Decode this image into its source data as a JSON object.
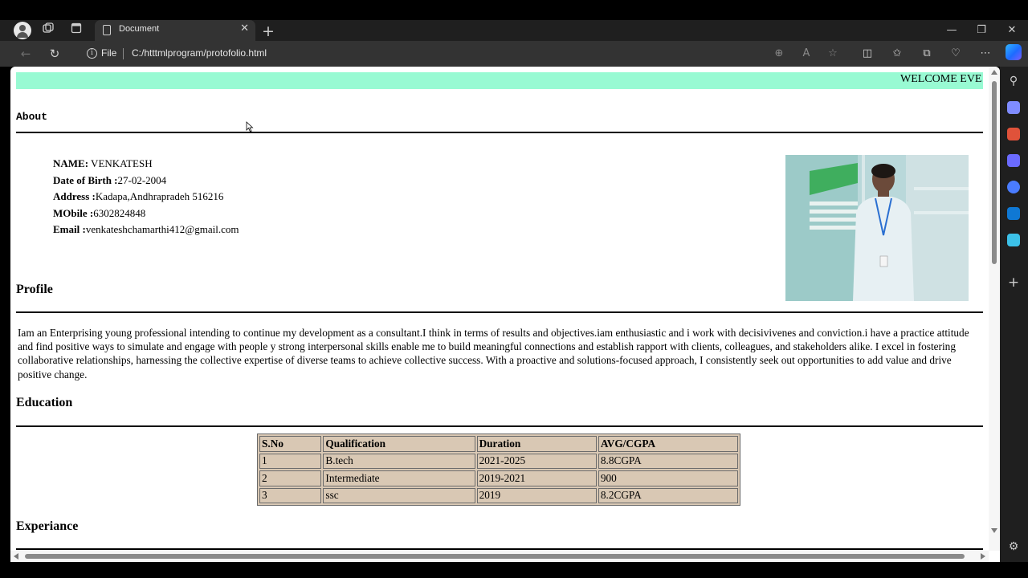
{
  "browser": {
    "tab_title": "Document",
    "tab_close": "✕",
    "new_tab": "+",
    "url_scheme": "File",
    "url": "C:/htttmlprogram/protofolio.html",
    "window_controls": {
      "minimize": "—",
      "restore": "❐",
      "close": "✕"
    }
  },
  "icons": {
    "back": "←",
    "reload": "↻",
    "zoom": "⊕",
    "read_aloud": "A",
    "favorite": "☆",
    "split": "◫",
    "favorites": "✩",
    "collections": "⧉",
    "performance": "♡",
    "more": "⋯",
    "search": "⚲",
    "add": "+",
    "settings": "⚙"
  },
  "sidebar_colors": [
    "#7f8cff",
    "#e0523a",
    "#6b6bff",
    "#4a7cff",
    "#0f78d4",
    "#3cc1e8"
  ],
  "page": {
    "marquee": "WELCOME EVE",
    "marquee_color": "#98fad3",
    "about_heading": "About",
    "details": [
      {
        "label": "NAME:",
        "value": " VENKATESH"
      },
      {
        "label": "Date of Birth :",
        "value": "27-02-2004"
      },
      {
        "label": "Address :",
        "value": "Kadapa,Andhrapradeh 516216"
      },
      {
        "label": "MObile :",
        "value": "6302824848"
      },
      {
        "label": "Email :",
        "value": "venkateshchamarthi412@gmail.com"
      }
    ],
    "profile_heading": "Profile",
    "profile_text": "Iam an Enterprising young professional intending to continue my development as a consultant.I think in terms of results and objectives.iam enthusiastic and i work with decisivivenes and conviction.i have a practice attitude and find positive ways to simulate and engage with people y strong interpersonal skills enable me to build meaningful connections and establish rapport with clients, colleagues, and stakeholders alike. I excel in fostering collaborative relationships, harnessing the collective expertise of diverse teams to achieve collective success. With a proactive and solutions-focused approach, I consistently seek out opportunities to add value and drive positive change.",
    "education_heading": "Education",
    "education_table": {
      "headers": [
        "S.No",
        "Qualification",
        "Duration",
        "AVG/CGPA"
      ],
      "rows": [
        [
          "1",
          "B.tech",
          "2021-2025",
          "8.8CGPA"
        ],
        [
          "2",
          "Intermediate",
          "2019-2021",
          "900"
        ],
        [
          "3",
          "ssc",
          "2019",
          "8.2CGPA"
        ]
      ]
    },
    "experience_heading": "Experiance"
  }
}
